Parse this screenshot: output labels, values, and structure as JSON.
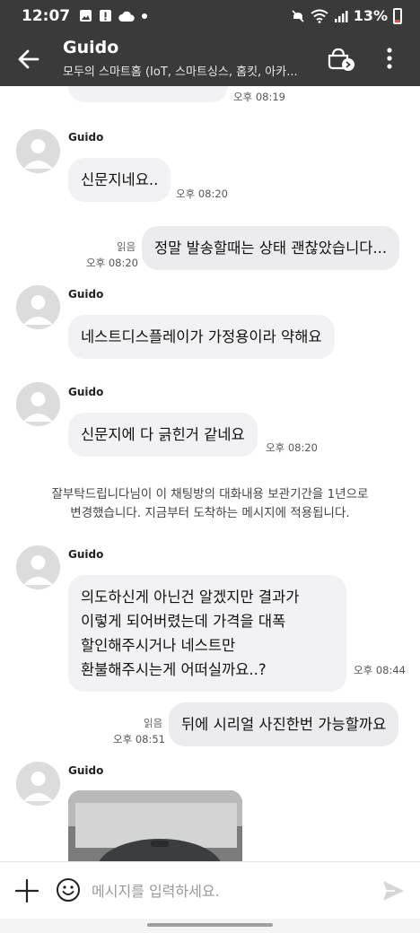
{
  "status_bar": {
    "time": "12:07",
    "battery": "13%"
  },
  "header": {
    "title": "Guido",
    "subtitle": "모두의 스마트홈 (IoT, 스마트싱스, 홈킷, 아카..."
  },
  "messages": [
    {
      "side": "them",
      "sender": "",
      "text": "",
      "time": "오후 08:19"
    },
    {
      "side": "them",
      "sender": "Guido",
      "text": "신문지네요..",
      "time": "오후 08:20"
    },
    {
      "side": "me",
      "read": "읽음",
      "text": "정말 발송할때는 상태 괜찮았습니다...",
      "time": "오후 08:20"
    },
    {
      "side": "them",
      "sender": "Guido",
      "text": "네스트디스플레이가 가정용이라 약해요",
      "time": ""
    },
    {
      "side": "them",
      "sender": "Guido",
      "text": "신문지에 다 긁힌거 같네요",
      "time": "오후 08:20"
    },
    {
      "side": "system",
      "text": "잘부탁드립니다님이 이 채팅방의 대화내용 보관기간을 1년으로\n변경했습니다. 지금부터 도착하는 메시지에 적용됩니다."
    },
    {
      "side": "them",
      "sender": "Guido",
      "text": "의도하신게 아닌건 알겠지만 결과가\n이렇게 되어버렸는데 가격을 대폭\n할인해주시거나 네스트만\n환불해주시는게 어떠실까요..?",
      "time": "오후 08:44"
    },
    {
      "side": "me",
      "read": "읽음",
      "text": "뒤에 시리얼 사진한번 가능할까요",
      "time": "오후 08:51"
    },
    {
      "side": "them",
      "sender": "Guido",
      "text": "",
      "time": ""
    }
  ],
  "input": {
    "placeholder": "메시지를 입력하세요.",
    "value": ""
  },
  "icons": {
    "back": "arrow-left-icon",
    "room_menu": "drawer-icon",
    "more": "more-vert-icon",
    "add": "plus-icon",
    "emoji": "emoji-icon",
    "send": "send-icon"
  },
  "colors": {
    "header_bg": "#3a3a3a",
    "bubble_bg": "#f2f2f4",
    "battery_low": "#e74c3c"
  }
}
